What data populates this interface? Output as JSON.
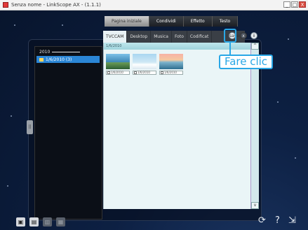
{
  "window": {
    "title": "Senza nome - LinkScope AX - (1.1.1)",
    "min_label": "_",
    "max_label": "□",
    "close_label": "X"
  },
  "top_tabs": [
    {
      "label": "Pagina iniziale",
      "active": true
    },
    {
      "label": "Condividi",
      "active": false
    },
    {
      "label": "Effetto",
      "active": false
    },
    {
      "label": "Testo",
      "active": false
    }
  ],
  "source_tabs": [
    {
      "label": "TVCCAM",
      "active": true
    },
    {
      "label": "Desktop",
      "active": false
    },
    {
      "label": "Musica",
      "active": false
    },
    {
      "label": "Foto",
      "active": false
    },
    {
      "label": "Codificat",
      "active": false
    }
  ],
  "tree": {
    "year": "2010",
    "items": [
      {
        "label": "1/6/2010 (3)"
      }
    ]
  },
  "content": {
    "header": "1/6/2010",
    "thumbnails": [
      {
        "caption": "1/6/2010"
      },
      {
        "caption": "1/6/2010"
      },
      {
        "caption": "1/6/2010"
      }
    ]
  },
  "callout": {
    "text": "Fare clic"
  },
  "buttons": {
    "save_icon": "save-icon",
    "close_icon": "x",
    "settings_icon": "ii",
    "scroll_up": "^",
    "scroll_down": "v",
    "side_handle": "||"
  },
  "bottom_toolbar": [
    {
      "icon": "camera-icon",
      "label": "▣",
      "dim": false
    },
    {
      "icon": "film-icon",
      "label": "▤",
      "dim": false
    },
    {
      "icon": "share-icon",
      "label": "▥",
      "dim": true
    },
    {
      "icon": "copy-icon",
      "label": "▦",
      "dim": true
    }
  ],
  "bottom_right": {
    "refresh_label": "⟳",
    "help_label": "?",
    "exit_label": "⇲"
  }
}
